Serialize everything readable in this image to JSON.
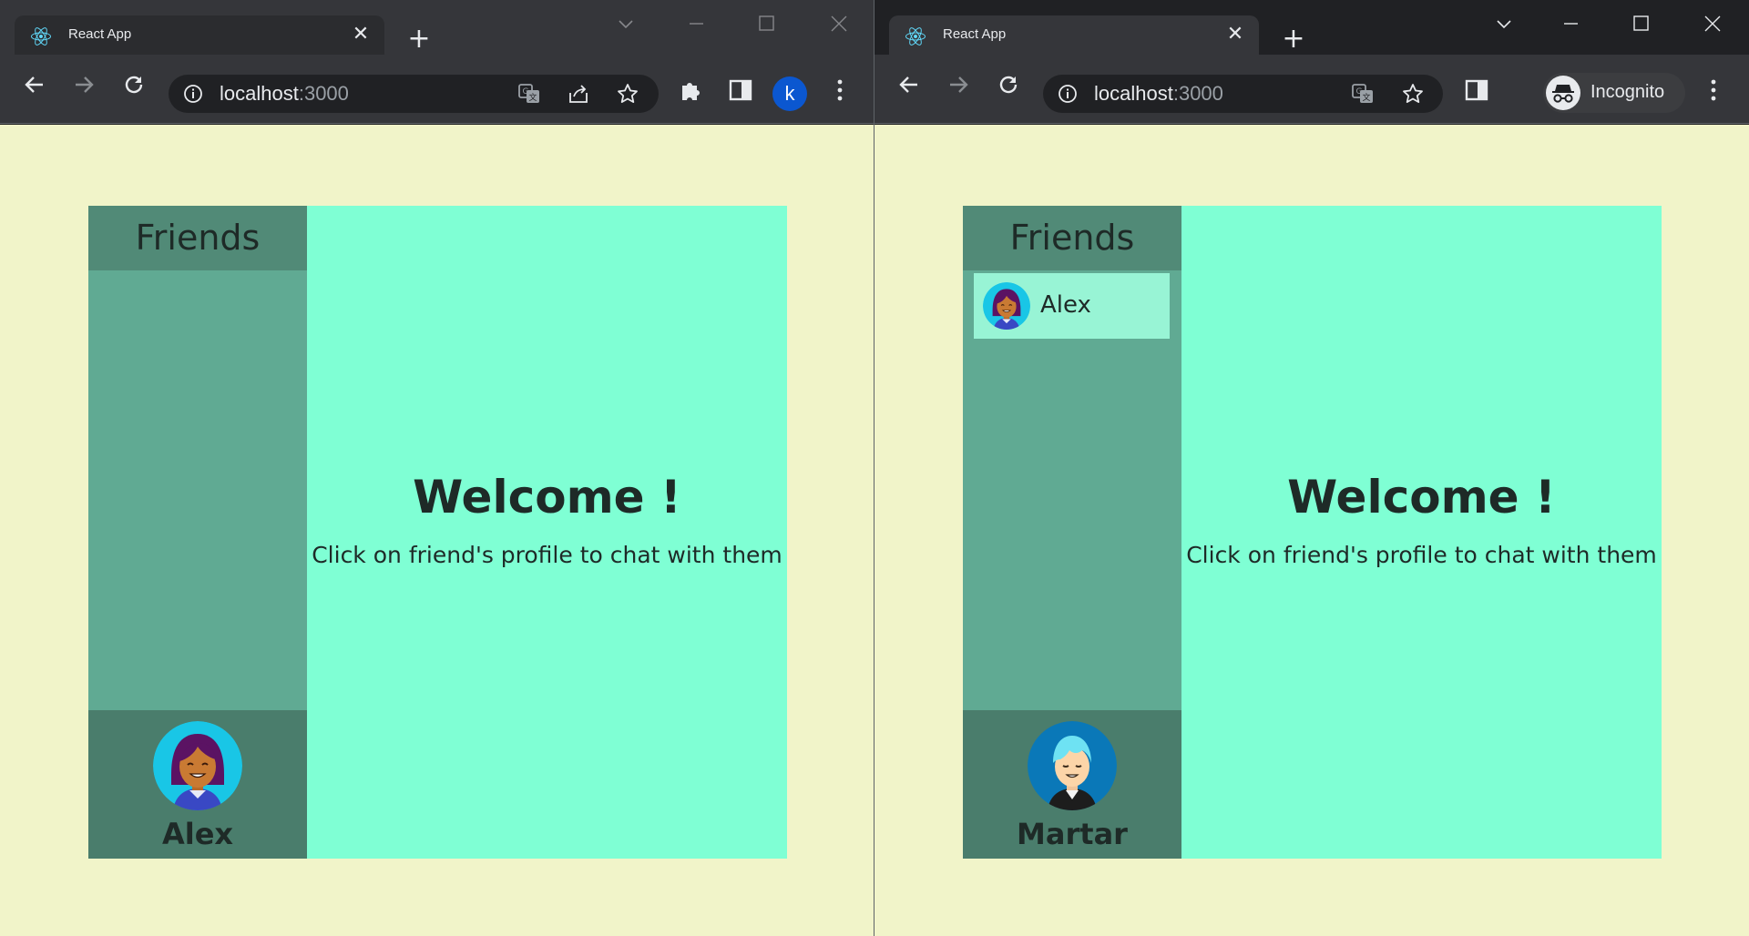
{
  "windows": [
    {
      "tab": {
        "title": "React App"
      },
      "address": {
        "host": "localhost",
        "port": ":3000"
      },
      "profile_initial": "k",
      "app": {
        "sidebar_title": "Friends",
        "friends": [],
        "current_user": "Alex",
        "welcome_title": "Welcome !",
        "welcome_hint": "Click on friend's profile to chat with them"
      }
    },
    {
      "tab": {
        "title": "React App"
      },
      "address": {
        "host": "localhost",
        "port": ":3000"
      },
      "incognito_label": "Incognito",
      "app": {
        "sidebar_title": "Friends",
        "friends": [
          {
            "name": "Alex"
          }
        ],
        "current_user": "Martar",
        "welcome_title": "Welcome !",
        "welcome_hint": "Click on friend's profile to chat with them"
      }
    }
  ],
  "colors": {
    "page_bg": "#f1f4c9",
    "sidebar": "#60aa93",
    "sidebar_header": "#518a77",
    "sidebar_footer": "#4a7d6c",
    "chat_area": "#7fffd4",
    "friend_item": "#98f4d5"
  }
}
